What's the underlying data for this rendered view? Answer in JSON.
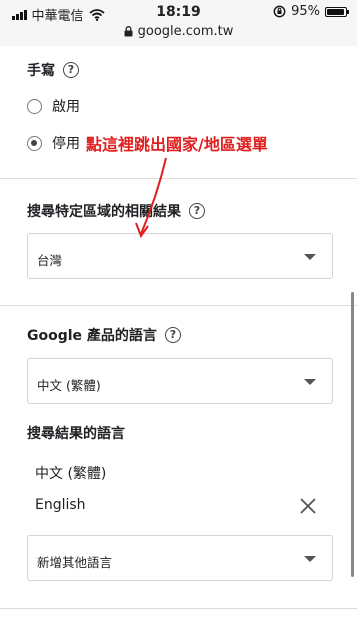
{
  "statusbar": {
    "carrier": "中華電信",
    "time": "18:19",
    "battery_text": "95%",
    "battery_level": 0.95,
    "url": "google.com.tw"
  },
  "handwriting": {
    "title": "手寫",
    "help_glyph": "?",
    "options": [
      "啟用",
      "停用"
    ],
    "selected": "停用"
  },
  "annotation": {
    "text": "點這裡跳出國家/地區選單",
    "color": "#e0201f"
  },
  "region": {
    "title": "搜尋特定區域的相關結果",
    "help_glyph": "?",
    "value": "台灣"
  },
  "product_language": {
    "title": "Google 產品的語言",
    "help_glyph": "?",
    "value": "中文 (繁體)"
  },
  "results_language": {
    "title": "搜尋結果的語言",
    "languages": [
      "中文 (繁體)",
      "English"
    ],
    "add_placeholder": "新增其他語言"
  }
}
